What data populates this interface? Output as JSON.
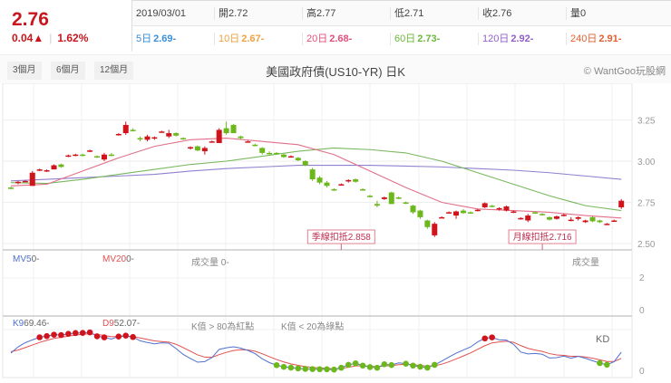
{
  "quote": {
    "price": "2.76",
    "change": "0.04▲",
    "percent": "1.62%"
  },
  "info": {
    "row1": [
      "2019/03/01",
      "開2.72",
      "高2.77",
      "低2.71",
      "收2.76",
      "量0"
    ],
    "ma": [
      {
        "label": "5日",
        "value": "2.69-",
        "color": "#3a8fd8"
      },
      {
        "label": "10日",
        "value": "2.67-",
        "color": "#f0a040"
      },
      {
        "label": "20日",
        "value": "2.68-",
        "color": "#e0507a"
      },
      {
        "label": "60日",
        "value": "2.73-",
        "color": "#6bb83a"
      },
      {
        "label": "120日",
        "value": "2.92-",
        "color": "#9060c8"
      },
      {
        "label": "240日",
        "value": "2.91-",
        "color": "#e06030"
      }
    ]
  },
  "toolbar": {
    "ranges": [
      "3個月",
      "6個月",
      "12個月"
    ],
    "title": "美國政府債(US10-YR) 日K",
    "brand": "© WantGoo玩股網"
  },
  "volume": {
    "mv5_label": "MV5",
    "mv5_value": "0-",
    "mv20_label": "MV20",
    "mv20_value": "0-",
    "vol_label": "成交量 0-",
    "vol_title": "成交量",
    "ticks": [
      "2",
      "0"
    ]
  },
  "kd": {
    "k_label": "K9",
    "k_value": "69.46-",
    "d_label": "D9",
    "d_value": "52.07-",
    "note1": "K值 > 80為紅點",
    "note2": "K值 < 20為綠點",
    "title": "KD",
    "ticks": [
      "0"
    ]
  },
  "colors": {
    "up": "#d0141c",
    "down": "#6cb81c",
    "ma20": "#e0708a",
    "ma60": "#7ab860",
    "ma240": "#9080d0",
    "k": "#5070d0",
    "d": "#e05050"
  },
  "chart_data": {
    "type": "candlestick",
    "title": "美國政府債(US10-YR) 日K",
    "yticks": [
      "3.25",
      "3.00",
      "2.75",
      "2.50"
    ],
    "ylim": [
      2.48,
      3.42
    ],
    "markers": [
      {
        "label": "季線扣抵2.858",
        "index": 47
      },
      {
        "label": "月線扣抵2.716",
        "index": 75
      }
    ],
    "candles": [
      [
        2.84,
        2.845,
        2.83,
        2.835
      ],
      [
        2.87,
        2.88,
        2.86,
        2.875
      ],
      [
        2.88,
        2.885,
        2.875,
        2.88
      ],
      [
        2.85,
        2.94,
        2.85,
        2.93
      ],
      [
        2.95,
        2.955,
        2.94,
        2.95
      ],
      [
        2.94,
        2.95,
        2.935,
        2.945
      ],
      [
        2.95,
        2.98,
        2.95,
        2.975
      ],
      [
        2.98,
        2.985,
        2.96,
        2.965
      ],
      [
        3.03,
        3.04,
        3.025,
        3.035
      ],
      [
        3.04,
        3.045,
        3.03,
        3.04
      ],
      [
        3.04,
        3.045,
        3.03,
        3.035
      ],
      [
        3.06,
        3.07,
        3.055,
        3.065
      ],
      [
        3.03,
        3.035,
        3.02,
        3.025
      ],
      [
        3.01,
        3.05,
        3.0,
        3.04
      ],
      [
        3.04,
        3.05,
        3.03,
        3.035
      ],
      [
        3.16,
        3.17,
        3.155,
        3.165
      ],
      [
        3.17,
        3.24,
        3.16,
        3.22
      ],
      [
        3.19,
        3.2,
        3.18,
        3.185
      ],
      [
        3.14,
        3.15,
        3.12,
        3.135
      ],
      [
        3.13,
        3.16,
        3.12,
        3.15
      ],
      [
        3.14,
        3.15,
        3.13,
        3.145
      ],
      [
        3.18,
        3.185,
        3.175,
        3.18
      ],
      [
        3.15,
        3.19,
        3.14,
        3.17
      ],
      [
        3.17,
        3.175,
        3.15,
        3.155
      ],
      [
        3.14,
        3.145,
        3.13,
        3.135
      ],
      [
        3.08,
        3.09,
        3.07,
        3.085
      ],
      [
        3.09,
        3.095,
        3.06,
        3.065
      ],
      [
        3.06,
        3.09,
        3.04,
        3.08
      ],
      [
        3.12,
        3.125,
        3.115,
        3.12
      ],
      [
        3.11,
        3.2,
        3.11,
        3.19
      ],
      [
        3.2,
        3.24,
        3.16,
        3.17
      ],
      [
        3.22,
        3.225,
        3.17,
        3.17
      ],
      [
        3.15,
        3.155,
        3.13,
        3.14
      ],
      [
        3.12,
        3.125,
        3.115,
        3.12
      ],
      [
        3.1,
        3.105,
        3.09,
        3.095
      ],
      [
        3.08,
        3.085,
        3.04,
        3.05
      ],
      [
        3.05,
        3.06,
        3.04,
        3.045
      ],
      [
        3.05,
        3.055,
        3.04,
        3.045
      ],
      [
        3.04,
        3.045,
        3.02,
        3.025
      ],
      [
        3.03,
        3.035,
        3.025,
        3.03
      ],
      [
        3.02,
        3.025,
        3.0,
        3.005
      ],
      [
        3.0,
        3.005,
        2.97,
        2.975
      ],
      [
        2.95,
        2.96,
        2.88,
        2.89
      ],
      [
        2.9,
        2.91,
        2.86,
        2.87
      ],
      [
        2.87,
        2.88,
        2.84,
        2.85
      ],
      [
        2.83,
        2.835,
        2.82,
        2.825
      ],
      [
        2.86,
        2.865,
        2.855,
        2.86
      ],
      [
        2.88,
        2.89,
        2.87,
        2.885
      ],
      [
        2.89,
        2.895,
        2.87,
        2.875
      ],
      [
        2.83,
        2.835,
        2.82,
        2.825
      ],
      [
        2.79,
        2.795,
        2.78,
        2.785
      ],
      [
        2.74,
        2.76,
        2.72,
        2.73
      ],
      [
        2.77,
        2.785,
        2.765,
        2.78
      ],
      [
        2.81,
        2.815,
        2.74,
        2.74
      ],
      [
        2.78,
        2.785,
        2.77,
        2.775
      ],
      [
        2.75,
        2.755,
        2.74,
        2.745
      ],
      [
        2.73,
        2.735,
        2.68,
        2.69
      ],
      [
        2.7,
        2.705,
        2.65,
        2.66
      ],
      [
        2.64,
        2.645,
        2.59,
        2.6
      ],
      [
        2.55,
        2.63,
        2.54,
        2.62
      ],
      [
        2.66,
        2.665,
        2.655,
        2.66
      ],
      [
        2.69,
        2.695,
        2.685,
        2.69
      ],
      [
        2.67,
        2.7,
        2.65,
        2.695
      ],
      [
        2.7,
        2.71,
        2.68,
        2.685
      ],
      [
        2.69,
        2.695,
        2.68,
        2.685
      ],
      [
        2.7,
        2.71,
        2.695,
        2.705
      ],
      [
        2.72,
        2.75,
        2.715,
        2.745
      ],
      [
        2.73,
        2.735,
        2.72,
        2.725
      ],
      [
        2.71,
        2.72,
        2.7,
        2.715
      ],
      [
        2.7,
        2.73,
        2.695,
        2.725
      ],
      [
        2.69,
        2.7,
        2.685,
        2.695
      ],
      [
        2.65,
        2.66,
        2.645,
        2.655
      ],
      [
        2.64,
        2.68,
        2.63,
        2.67
      ],
      [
        2.69,
        2.695,
        2.68,
        2.685
      ],
      [
        2.68,
        2.685,
        2.67,
        2.675
      ],
      [
        2.66,
        2.665,
        2.64,
        2.645
      ],
      [
        2.65,
        2.67,
        2.645,
        2.665
      ],
      [
        2.67,
        2.68,
        2.665,
        2.675
      ],
      [
        2.64,
        2.66,
        2.635,
        2.645
      ],
      [
        2.65,
        2.665,
        2.64,
        2.66
      ],
      [
        2.63,
        2.645,
        2.625,
        2.64
      ],
      [
        2.66,
        2.665,
        2.63,
        2.635
      ],
      [
        2.64,
        2.645,
        2.625,
        2.63
      ],
      [
        2.62,
        2.625,
        2.615,
        2.62
      ],
      [
        2.64,
        2.645,
        2.635,
        2.64
      ],
      [
        2.72,
        2.77,
        2.71,
        2.76
      ]
    ],
    "ma_index": [
      1,
      6,
      11,
      16,
      21,
      26,
      31,
      36,
      41,
      46,
      51,
      56,
      61,
      66,
      71,
      76,
      81,
      86
    ],
    "ma20": [
      2.85,
      2.86,
      2.94,
      3.02,
      3.09,
      3.13,
      3.14,
      3.12,
      3.1,
      3.04,
      2.94,
      2.84,
      2.75,
      2.71,
      2.7,
      2.69,
      2.67,
      2.655
    ],
    "ma60": [
      2.87,
      2.865,
      2.89,
      2.92,
      2.95,
      2.98,
      3.0,
      3.03,
      3.06,
      3.08,
      3.07,
      3.05,
      3.0,
      2.93,
      2.86,
      2.79,
      2.73,
      2.7
    ],
    "ma240": [
      2.88,
      2.89,
      2.9,
      2.91,
      2.92,
      2.94,
      2.955,
      2.965,
      2.975,
      2.975,
      2.975,
      2.97,
      2.965,
      2.955,
      2.945,
      2.93,
      2.91,
      2.89
    ]
  }
}
